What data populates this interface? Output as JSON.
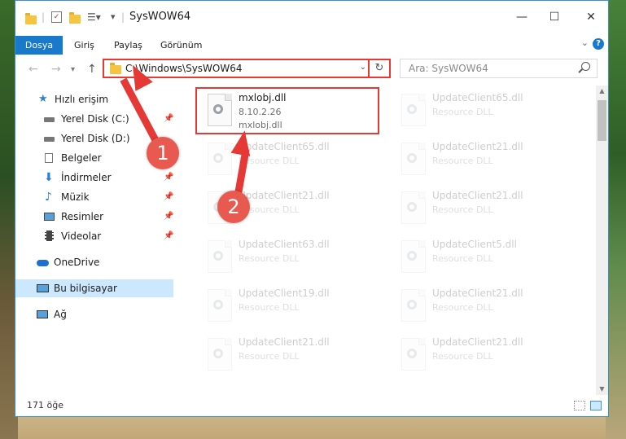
{
  "window": {
    "title": "SysWOW64",
    "buttons": {
      "minimize": "—",
      "maximize": "☐",
      "close": "✕"
    }
  },
  "ribbon": {
    "tabs": [
      "Dosya",
      "Giriş",
      "Paylaş",
      "Görünüm"
    ],
    "help": "?"
  },
  "nav": {
    "back": "←",
    "forward": "→",
    "recent": "▾",
    "up": "↑",
    "address": "C:\\Windows\\SysWOW64",
    "search_placeholder": "Ara: SysWOW64"
  },
  "sidebar": {
    "items": [
      {
        "label": "Hızlı erişim",
        "pinned": false
      },
      {
        "label": "Yerel Disk (C:)",
        "pinned": true
      },
      {
        "label": "Yerel Disk (D:)",
        "pinned": false
      },
      {
        "label": "Belgeler",
        "pinned": true
      },
      {
        "label": "İndirmeler",
        "pinned": true
      },
      {
        "label": "Müzik",
        "pinned": true
      },
      {
        "label": "Resimler",
        "pinned": true
      },
      {
        "label": "Videolar",
        "pinned": true
      },
      {
        "label": "OneDrive",
        "pinned": false
      },
      {
        "label": "Bu bilgisayar",
        "pinned": false,
        "selected": true
      },
      {
        "label": "Ağ",
        "pinned": false
      }
    ]
  },
  "files": {
    "main": {
      "name": "mxlobj.dll",
      "version": "8.10.2.26",
      "desc": "mxlobj.dll"
    },
    "left": [
      {
        "name": "UpdateClient65.dll",
        "desc": "Resource DLL"
      },
      {
        "name": "UpdateClient21.dll",
        "desc": "Resource DLL"
      },
      {
        "name": "UpdateClient63.dll",
        "desc": "Resource DLL"
      },
      {
        "name": "UpdateClient19.dll",
        "desc": "Resource DLL"
      },
      {
        "name": "UpdateClient21.dll",
        "desc": "Resource DLL"
      }
    ],
    "right": [
      {
        "name": "UpdateClient65.dll",
        "desc": "Resource DLL"
      },
      {
        "name": "UpdateClient21.dll",
        "desc": "Resource DLL"
      },
      {
        "name": "UpdateClient21.dll",
        "desc": "Resource DLL"
      },
      {
        "name": "UpdateClient5.dll",
        "desc": "Resource DLL"
      },
      {
        "name": "UpdateClient21.dll",
        "desc": "Resource DLL"
      },
      {
        "name": "UpdateClient21.dll",
        "desc": "Resource DLL"
      }
    ]
  },
  "status": {
    "count": "171 öğe"
  },
  "annotations": {
    "badge1": "1",
    "badge2": "2"
  }
}
